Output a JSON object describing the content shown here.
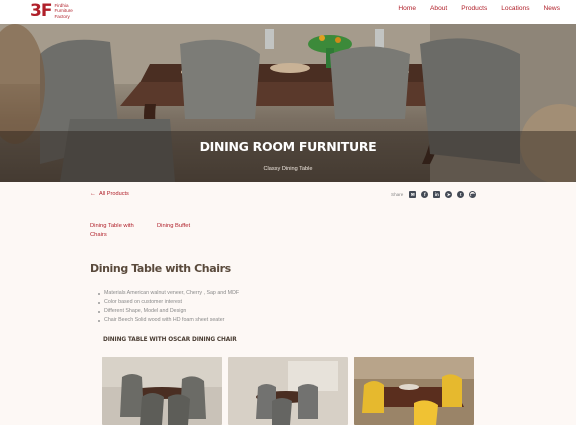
{
  "header": {
    "logo_mark": "3F",
    "logo_lines": [
      "Firdhia",
      "Furniture",
      "Factory"
    ],
    "nav": [
      {
        "label": "Home"
      },
      {
        "label": "About"
      },
      {
        "label": "Products"
      },
      {
        "label": "Locations"
      },
      {
        "label": "News"
      }
    ]
  },
  "hero": {
    "title": "DINING ROOM FURNITURE",
    "subtitle": "Classy Dining Table"
  },
  "back_link": "All Products",
  "share": {
    "label": "Share",
    "icons": [
      "email-icon",
      "facebook-icon",
      "linkedin-icon",
      "telegram-icon",
      "twitter-icon",
      "whatsapp-icon"
    ]
  },
  "categories": [
    "Dining Table with Chairs",
    "Dining Buffet"
  ],
  "section": {
    "title": "Dining Table with Chairs",
    "bullets": [
      "Materials American walnut veneer, Cherry , Sap and MDF",
      "Color based on customer interest",
      "Different Shape, Model and Design",
      "Chair Beech Solid wood with HD foam sheet seater"
    ],
    "subtitle": "DINING TABLE WITH OSCAR DINING CHAIR"
  },
  "colors": {
    "brand": "#b0202a",
    "background": "#fdf8f5",
    "heading": "#5a4a3c"
  }
}
